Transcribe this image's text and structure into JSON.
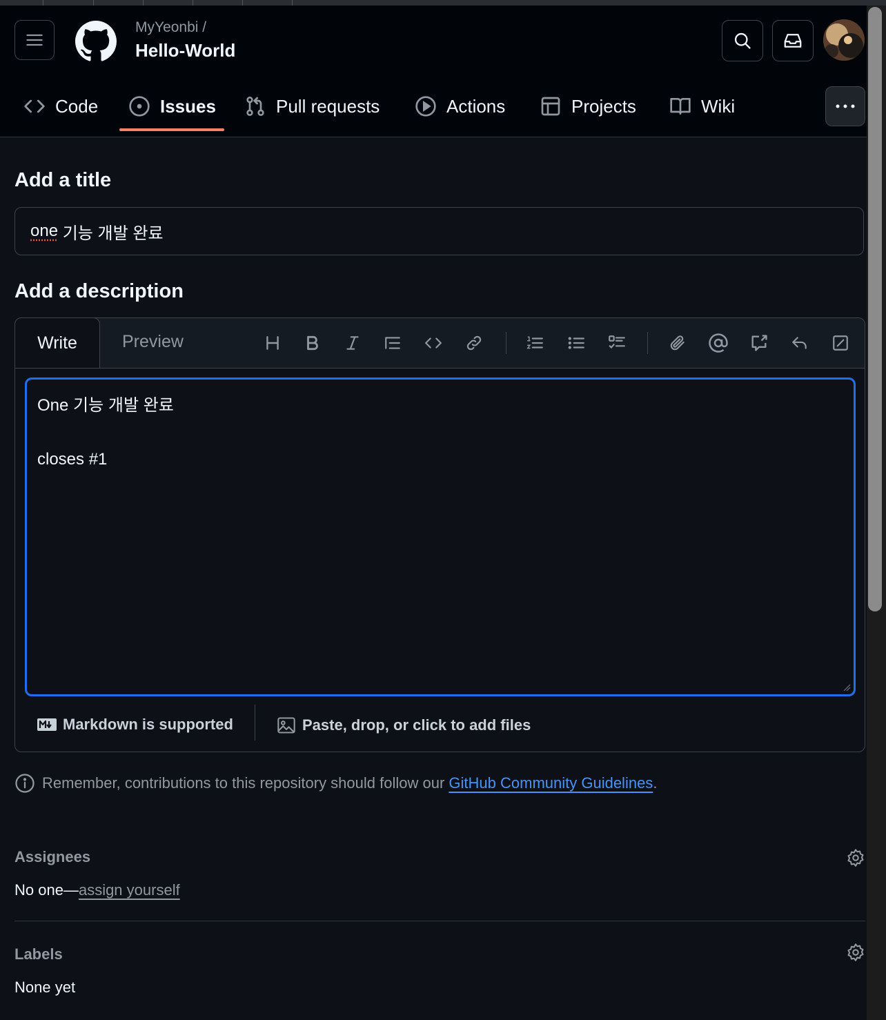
{
  "header": {
    "owner": "MyYeonbi /",
    "repo": "Hello-World",
    "more_label": "···"
  },
  "nav": {
    "tabs": [
      {
        "label": "Code",
        "icon": "code-icon"
      },
      {
        "label": "Issues",
        "icon": "issue-opened-icon",
        "selected": true
      },
      {
        "label": "Pull requests",
        "icon": "git-pull-request-icon"
      },
      {
        "label": "Actions",
        "icon": "play-icon"
      },
      {
        "label": "Projects",
        "icon": "table-icon"
      },
      {
        "label": "Wiki",
        "icon": "book-icon"
      }
    ],
    "selected_color": "#f78166"
  },
  "form": {
    "title_heading": "Add a title",
    "title_value_word": "one",
    "title_value_rest": " 기능 개발 완료",
    "description_heading": "Add a description",
    "tab_write": "Write",
    "tab_preview": "Preview",
    "body_line1": "One 기능 개발 완료",
    "body_line2": "closes #1",
    "markdown_note": "Markdown is supported",
    "attach_note": "Paste, drop, or click to add files"
  },
  "toolbar": [
    "heading-icon",
    "bold-icon",
    "italic-icon",
    "quote-icon",
    "code-icon",
    "link-icon",
    "ordered-list-icon",
    "unordered-list-icon",
    "task-list-icon",
    "paperclip-icon",
    "mention-icon",
    "cross-reference-icon",
    "reply-icon",
    "fullscreen-icon"
  ],
  "notice": {
    "text": "Remember, contributions to this repository should follow our ",
    "link": "GitHub Community Guidelines",
    "end": "."
  },
  "sidebar": {
    "assignees_label": "Assignees",
    "assignees_prefix": "No one—",
    "assignees_link": "assign yourself",
    "labels_label": "Labels",
    "labels_value": "None yet"
  },
  "colors": {
    "accent": "#1f6feb",
    "link": "#4493f8",
    "background": "#0d1117"
  }
}
